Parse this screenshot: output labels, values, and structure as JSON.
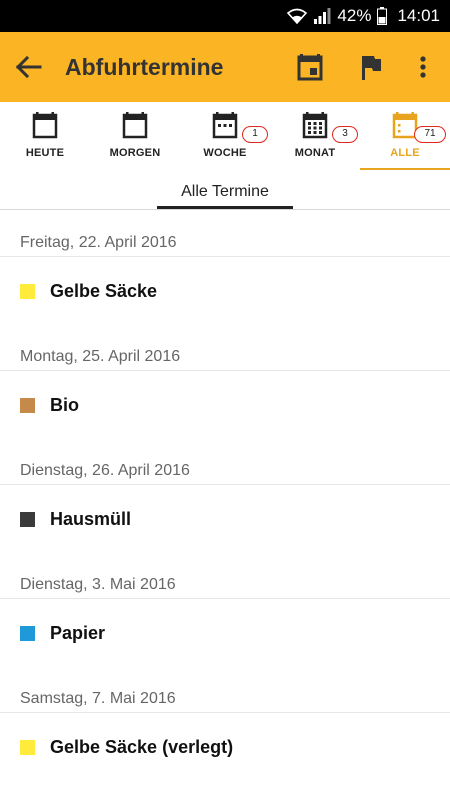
{
  "status_bar": {
    "battery_percent": "42%",
    "time": "14:01"
  },
  "app_bar": {
    "title": "Abfuhrtermine",
    "background": "#FBB423",
    "icons": [
      "arrow-back-icon",
      "calendar-icon",
      "flag-icon",
      "more-vertical-icon"
    ]
  },
  "tabs": [
    {
      "label": "HEUTE",
      "badge": null,
      "icon": "calendar-day-icon"
    },
    {
      "label": "MORGEN",
      "badge": null,
      "icon": "calendar-day-icon"
    },
    {
      "label": "WOCHE",
      "badge": "1",
      "icon": "calendar-week-icon"
    },
    {
      "label": "MONAT",
      "badge": "3",
      "icon": "calendar-month-icon"
    },
    {
      "label": "ALLE",
      "badge": "71",
      "icon": "calendar-all-icon",
      "active": true
    }
  ],
  "section_title": "Alle Termine",
  "groups": [
    {
      "date": "Freitag, 22. April 2016",
      "entry": "Gelbe Säcke",
      "color": "#FFEB3B"
    },
    {
      "date": "Montag, 25. April 2016",
      "entry": "Bio",
      "color": "#C58A4A"
    },
    {
      "date": "Dienstag, 26. April 2016",
      "entry": "Hausmüll",
      "color": "#3A3A3A"
    },
    {
      "date": "Dienstag, 3. Mai 2016",
      "entry": "Papier",
      "color": "#1E9AD8"
    },
    {
      "date": "Samstag, 7. Mai 2016",
      "entry": "Gelbe Säcke (verlegt)",
      "color": "#FFEB3B"
    }
  ]
}
